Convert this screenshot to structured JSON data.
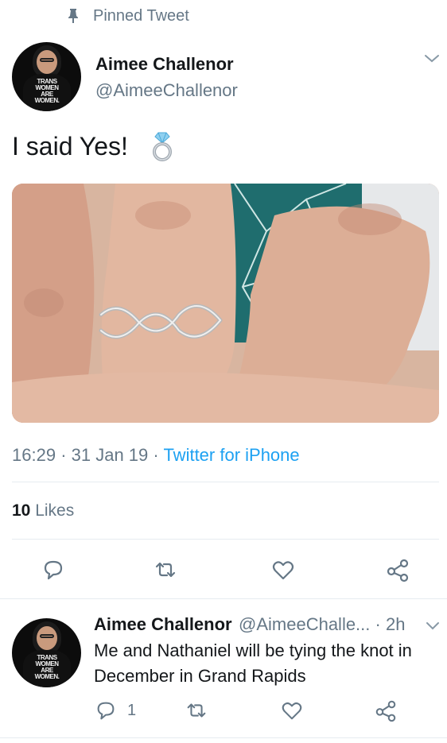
{
  "pinned": {
    "label": "Pinned Tweet",
    "icon": "pin-icon"
  },
  "tweet": {
    "author_name": "Aimee Challenor",
    "author_handle": "@AimeeChallenor",
    "avatar_shirt_text": [
      "TRANS",
      "WOMEN",
      "ARE",
      "WOMEN."
    ],
    "text": "I said Yes!",
    "emoji": "ring-emoji",
    "time": "16:29",
    "separator": "·",
    "date": "31 Jan 19",
    "source": "Twitter for iPhone",
    "likes_count": "10",
    "likes_label": "Likes",
    "actions": [
      "reply-icon",
      "retweet-icon",
      "like-icon",
      "share-icon"
    ]
  },
  "reply": {
    "author_name": "Aimee Challenor",
    "author_handle": "@AimeeChalle...",
    "time_ago": "2h",
    "separator": "·",
    "text": "Me and Nathaniel will be tying the knot in December in Grand Rapids",
    "reply_count": "1",
    "actions": [
      "reply-icon",
      "retweet-icon",
      "like-icon",
      "share-icon"
    ]
  },
  "colors": {
    "link": "#1da1f2",
    "secondary_text": "#657786",
    "primary_text": "#14171a",
    "divider": "#e6ecf0"
  }
}
